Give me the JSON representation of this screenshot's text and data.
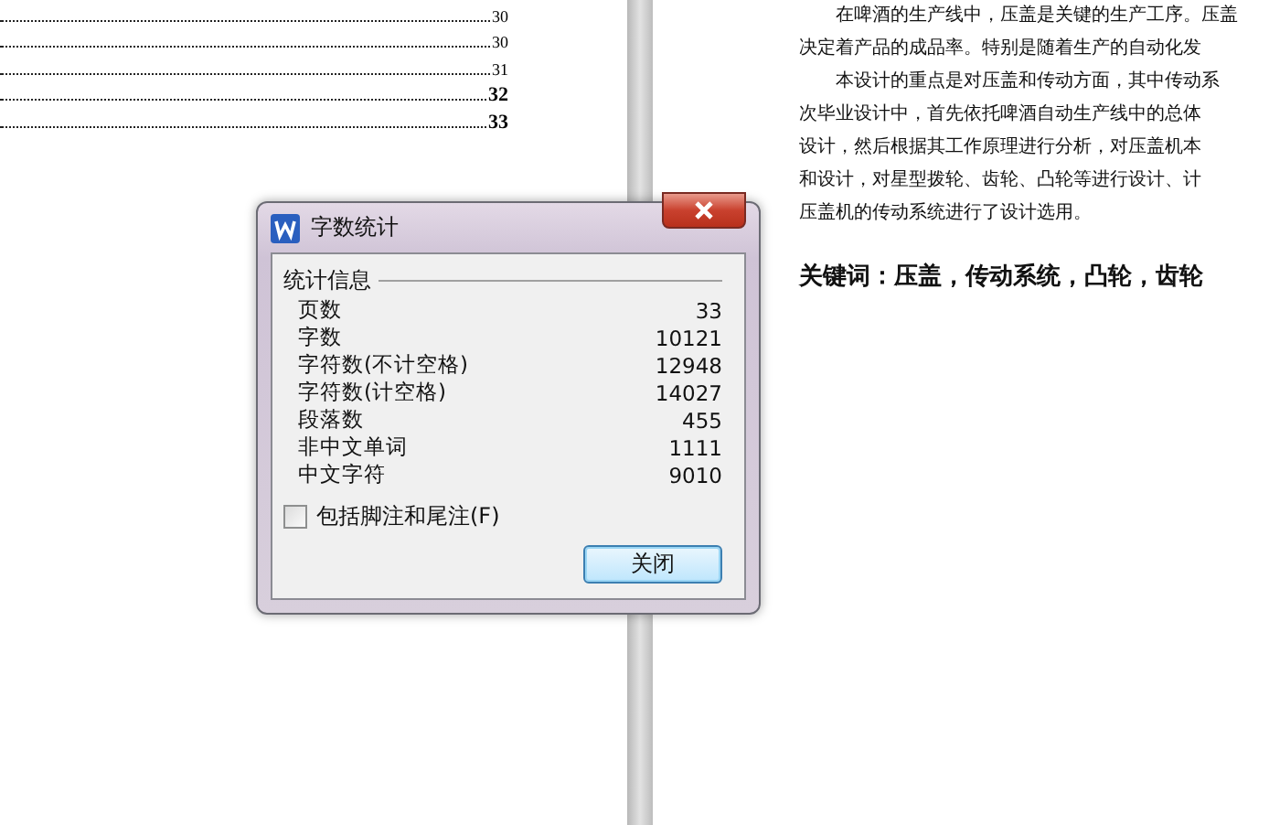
{
  "toc": [
    {
      "page": "30",
      "bold": false
    },
    {
      "page": "30",
      "bold": false
    },
    {
      "page": "31",
      "bold": false
    },
    {
      "page": "32",
      "bold": true
    },
    {
      "page": "33",
      "bold": true
    }
  ],
  "document": {
    "paragraphs": [
      {
        "text": "在啤酒的生产线中，压盖是关键的生产工序。压盖",
        "indent": true
      },
      {
        "text": "决定着产品的成品率。特别是随着生产的自动化发",
        "indent": false
      },
      {
        "text": "本设计的重点是对压盖和传动方面，其中传动系",
        "indent": true
      },
      {
        "text": "次毕业设计中，首先依托啤酒自动生产线中的总体",
        "indent": false
      },
      {
        "text": "设计，然后根据其工作原理进行分析，对压盖机本",
        "indent": false
      },
      {
        "text": "和设计，对星型拨轮、齿轮、凸轮等进行设计、计",
        "indent": false
      },
      {
        "text": "压盖机的传动系统进行了设计选用。",
        "indent": false
      }
    ],
    "keywords": "关键词：压盖，传动系统，凸轮，齿轮"
  },
  "dialog": {
    "title": "字数统计",
    "group": "统计信息",
    "stats": [
      {
        "label": "页数",
        "value": "33"
      },
      {
        "label": "字数",
        "value": "10121"
      },
      {
        "label": "字符数(不计空格)",
        "value": "12948"
      },
      {
        "label": "字符数(计空格)",
        "value": "14027"
      },
      {
        "label": "段落数",
        "value": "455"
      },
      {
        "label": "非中文单词",
        "value": "1111"
      },
      {
        "label": "中文字符",
        "value": "9010"
      }
    ],
    "checkbox": {
      "label": "包括脚注和尾注(F)",
      "checked": false
    },
    "button": "关闭"
  }
}
